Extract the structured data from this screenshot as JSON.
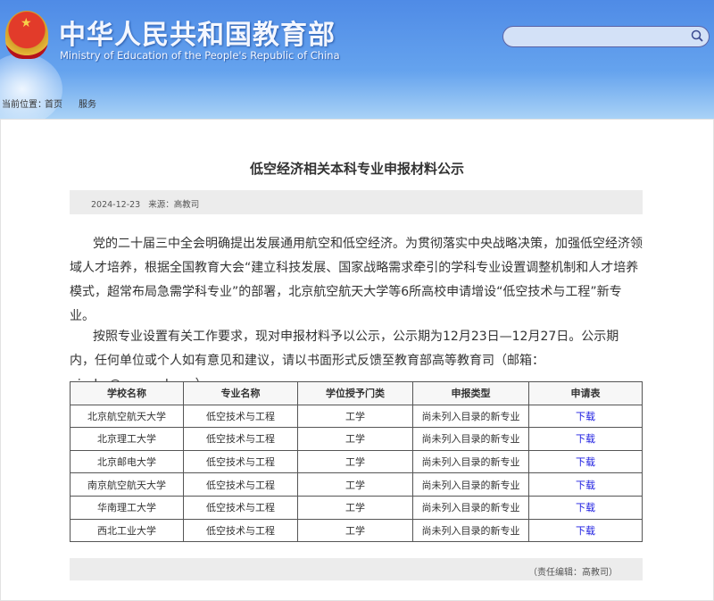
{
  "header": {
    "title_cn": "中华人民共和国教育部",
    "title_en": "Ministry of Education of the People's Republic of China",
    "search_placeholder": ""
  },
  "breadcrumb": {
    "label": "当前位置：",
    "home": "首页",
    "section": "服务"
  },
  "article": {
    "title": "低空经济相关本科专业申报材料公示",
    "date": "2024-12-23",
    "source": "来源：高教司",
    "paragraphs": [
      "党的二十届三中全会明确提出发展通用航空和低空经济。为贯彻落实中央战略决策，加强低空经济领域人才培养，根据全国教育大会“建立科技发展、国家战略需求牵引的学科专业设置调整机制和人才培养模式，超常布局急需学科专业”的部署，北京航空航天大学等6所高校申请增设“低空技术与工程”新专业。",
      "按照专业设置有关工作要求，现对申报材料予以公示，公示期为12月23日—12月27日。公示期内，任何单位或个人如有意见和建议，请以书面形式反馈至教育部高等教育司（邮箱：gjszhc@moe.edu.cn）。"
    ],
    "table": {
      "headers": [
        "学校名称",
        "专业名称",
        "学位授予门类",
        "申报类型",
        "申请表"
      ],
      "rows": [
        [
          "北京航空航天大学",
          "低空技术与工程",
          "工学",
          "尚未列入目录的新专业",
          "下载"
        ],
        [
          "北京理工大学",
          "低空技术与工程",
          "工学",
          "尚未列入目录的新专业",
          "下载"
        ],
        [
          "北京邮电大学",
          "低空技术与工程",
          "工学",
          "尚未列入目录的新专业",
          "下载"
        ],
        [
          "南京航空航天大学",
          "低空技术与工程",
          "工学",
          "尚未列入目录的新专业",
          "下载"
        ],
        [
          "华南理工大学",
          "低空技术与工程",
          "工学",
          "尚未列入目录的新专业",
          "下载"
        ],
        [
          "西北工业大学",
          "低空技术与工程",
          "工学",
          "尚未列入目录的新专业",
          "下载"
        ]
      ]
    },
    "editor": "（责任编辑：高教司）"
  }
}
